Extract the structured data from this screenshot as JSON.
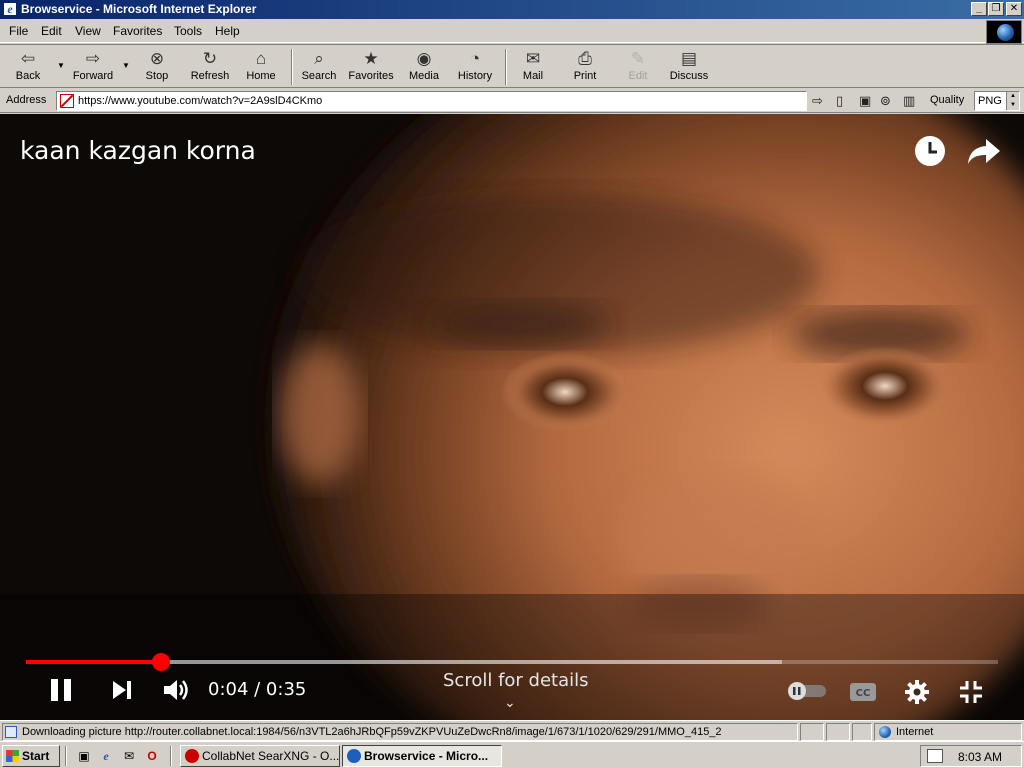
{
  "window": {
    "title": "Browservice - Microsoft Internet Explorer",
    "controls": [
      "_",
      "❐",
      "✕"
    ]
  },
  "menu": [
    "File",
    "Edit",
    "View",
    "Favorites",
    "Tools",
    "Help"
  ],
  "toolbar": {
    "back": "Back",
    "forward": "Forward",
    "stop": "Stop",
    "refresh": "Refresh",
    "home": "Home",
    "search": "Search",
    "favorites": "Favorites",
    "media": "Media",
    "history": "History",
    "mail": "Mail",
    "print": "Print",
    "edit": "Edit",
    "discuss": "Discuss"
  },
  "address": {
    "label": "Address",
    "url": "https://www.youtube.com/watch?v=2A9slD4CKmo",
    "quality_label": "Quality",
    "quality_value": "PNG"
  },
  "video": {
    "title": "kaan kazgan korna",
    "current_time": "0:04",
    "duration": "0:35",
    "time_display": "0:04 / 0:35",
    "played_fraction": 0.139,
    "buffered_fraction": 0.778,
    "scroll_hint": "Scroll for details"
  },
  "status": {
    "text": "Downloading picture http://router.collabnet.local:1984/56/n3VTL2a6hJRbQFp59vZKPVUuZeDwcRn8/image/1/673/1/1020/629/291/MMO_415_2",
    "zone": "Internet"
  },
  "taskbar": {
    "start": "Start",
    "tasks": [
      {
        "label": "CollabNet SearXNG - O...",
        "active": false,
        "color": "#cc0000"
      },
      {
        "label": "Browservice - Micro...",
        "active": true,
        "color": "#1d5fbf"
      }
    ],
    "clock": "8:03 AM"
  },
  "colors": {
    "titlebar": "#0a246a",
    "progress": "#ff0000",
    "face": "#d4d0c8"
  }
}
